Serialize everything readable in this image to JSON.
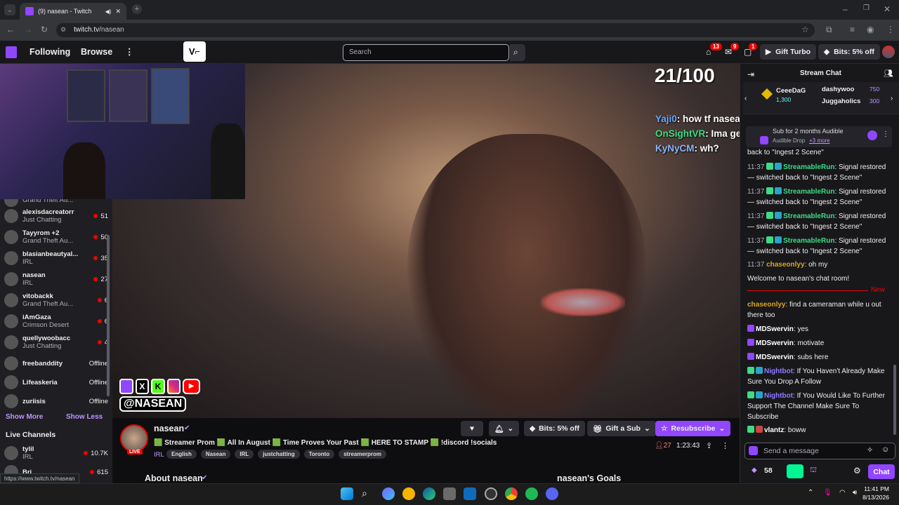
{
  "browser": {
    "tab_title": "(9) nasean - Twitch",
    "url_host": "twitch.tv",
    "url_path": "/nasean",
    "status_url": "https://www.twitch.tv/nasean"
  },
  "topnav": {
    "following": "Following",
    "browse": "Browse",
    "search_placeholder": "Search",
    "badges": [
      "13",
      "9",
      "1"
    ],
    "gift_turbo": "Gift Turbo",
    "bits": "Bits: 5% off"
  },
  "sidebar": {
    "channels": [
      {
        "name": "",
        "game": "Grand Theft Au...",
        "viewers": ""
      },
      {
        "name": "alexisdacreatorr",
        "game": "Just Chatting",
        "viewers": "51"
      },
      {
        "name": "Tayyrom +2",
        "game": "Grand Theft Au...",
        "viewers": "50"
      },
      {
        "name": "blasianbeautyal...",
        "game": "IRL",
        "viewers": "35"
      },
      {
        "name": "nasean",
        "game": "IRL",
        "viewers": "27"
      },
      {
        "name": "vitobackk",
        "game": "Grand Theft Au...",
        "viewers": "6"
      },
      {
        "name": "iAmGaza",
        "game": "Crimson Desert",
        "viewers": "6"
      },
      {
        "name": "quellywoobacc",
        "game": "Just Chatting",
        "viewers": "4"
      },
      {
        "name": "freebanddity",
        "game": "",
        "viewers": "Offline"
      },
      {
        "name": "Lifeaskeria",
        "game": "",
        "viewers": "Offline"
      },
      {
        "name": "zuriisis",
        "game": "",
        "viewers": "Offline"
      }
    ],
    "show_more": "Show More",
    "show_less": "Show Less",
    "live_channels": "Live Channels",
    "live": [
      {
        "name": "tylil",
        "game": "IRL",
        "viewers": "10.7K"
      },
      {
        "name": "Bri",
        "game": "",
        "viewers": "615"
      }
    ]
  },
  "player": {
    "counter": "21/100",
    "overlay_chat": [
      {
        "user": "Yaji0",
        "color": "#6aa8ff",
        "text": ": how tf nasean sneak in there"
      },
      {
        "user": "OnSightVR",
        "color": "#3ddc84",
        "text": ": Ima get u right, I work there"
      },
      {
        "user": "KyNyCM",
        "color": "#8ab4f8",
        "text": ": wh?"
      }
    ],
    "social_handle": "@NASEAN"
  },
  "stream": {
    "streamer": "nasean",
    "live": "LIVE",
    "title": "🟩 Streamer Prom 🟩 All In August 🟩 Time Proves Your Past 🟩 HERE TO STAMP 🟩 !discord !socials",
    "category": "IRL",
    "tags": [
      "English",
      "Nasean",
      "IRL",
      "justchatting",
      "Toronto",
      "streamerprom"
    ],
    "bits": "Bits: 5% off",
    "gift_sub": "Gift a Sub",
    "resubscribe": "Resubscribe",
    "viewers": "27",
    "uptime": "1:23:43",
    "about": "About nasean",
    "goals": "nasean's Goals"
  },
  "chat": {
    "header": "Stream Chat",
    "leaderboard": [
      {
        "name": "CeeeDaG",
        "amount": "1,300"
      },
      {
        "name": "dashywoo",
        "amount": "750"
      },
      {
        "name": "Juggaholics",
        "amount": "300"
      }
    ],
    "drop_text": "Sub for 2 months Audible",
    "drop_sub": "Audible Drop",
    "drop_more": "+3 more",
    "partial_line": "back to \"Ingest 2 Scene\"",
    "messages": [
      {
        "time": "11:37",
        "user": "StreamableRun",
        "color": "#3ddc84",
        "text": ": Signal restored — switched back to \"Ingest 2 Scene\""
      },
      {
        "time": "11:37",
        "user": "StreamableRun",
        "color": "#3ddc84",
        "text": ": Signal restored — switched back to \"Ingest 2 Scene\""
      },
      {
        "time": "11:37",
        "user": "StreamableRun",
        "color": "#3ddc84",
        "text": ": Signal restored — switched back to \"Ingest 2 Scene\""
      },
      {
        "time": "11:37",
        "user": "StreamableRun",
        "color": "#3ddc84",
        "text": ": Signal restored — switched back to \"Ingest 2 Scene\""
      },
      {
        "time": "11:37",
        "user": "chaseonlyy",
        "color": "#daa520",
        "text": ": oh my"
      }
    ],
    "welcome": "Welcome to nasean's chat room!",
    "new_label": "New",
    "new_messages": [
      {
        "user": "chaseonlyy",
        "color": "#daa520",
        "text": ": find a cameraman while u out there too"
      },
      {
        "user": "MDSwervin",
        "color": "#ffffff",
        "text": ": yes"
      },
      {
        "user": "MDSwervin",
        "color": "#ffffff",
        "text": ": motivate"
      },
      {
        "user": "MDSwervin",
        "color": "#ffffff",
        "text": ": subs here"
      },
      {
        "user": "Nightbot",
        "color": "#8f7bff",
        "text": ": If You Haven't Already Make Sure You Drop A Follow"
      },
      {
        "user": "Nightbot",
        "color": "#8f7bff",
        "text": ": If You Would Like To Further Support The Channel Make Sure To Subscribe"
      },
      {
        "user": "vlantz",
        "color": "#ffffff",
        "text": ": boww"
      }
    ],
    "input_placeholder": "Send a message",
    "points": "58",
    "chat_button": "Chat"
  },
  "taskbar": {
    "time": "11:41 PM",
    "date": "8/13/2026"
  }
}
